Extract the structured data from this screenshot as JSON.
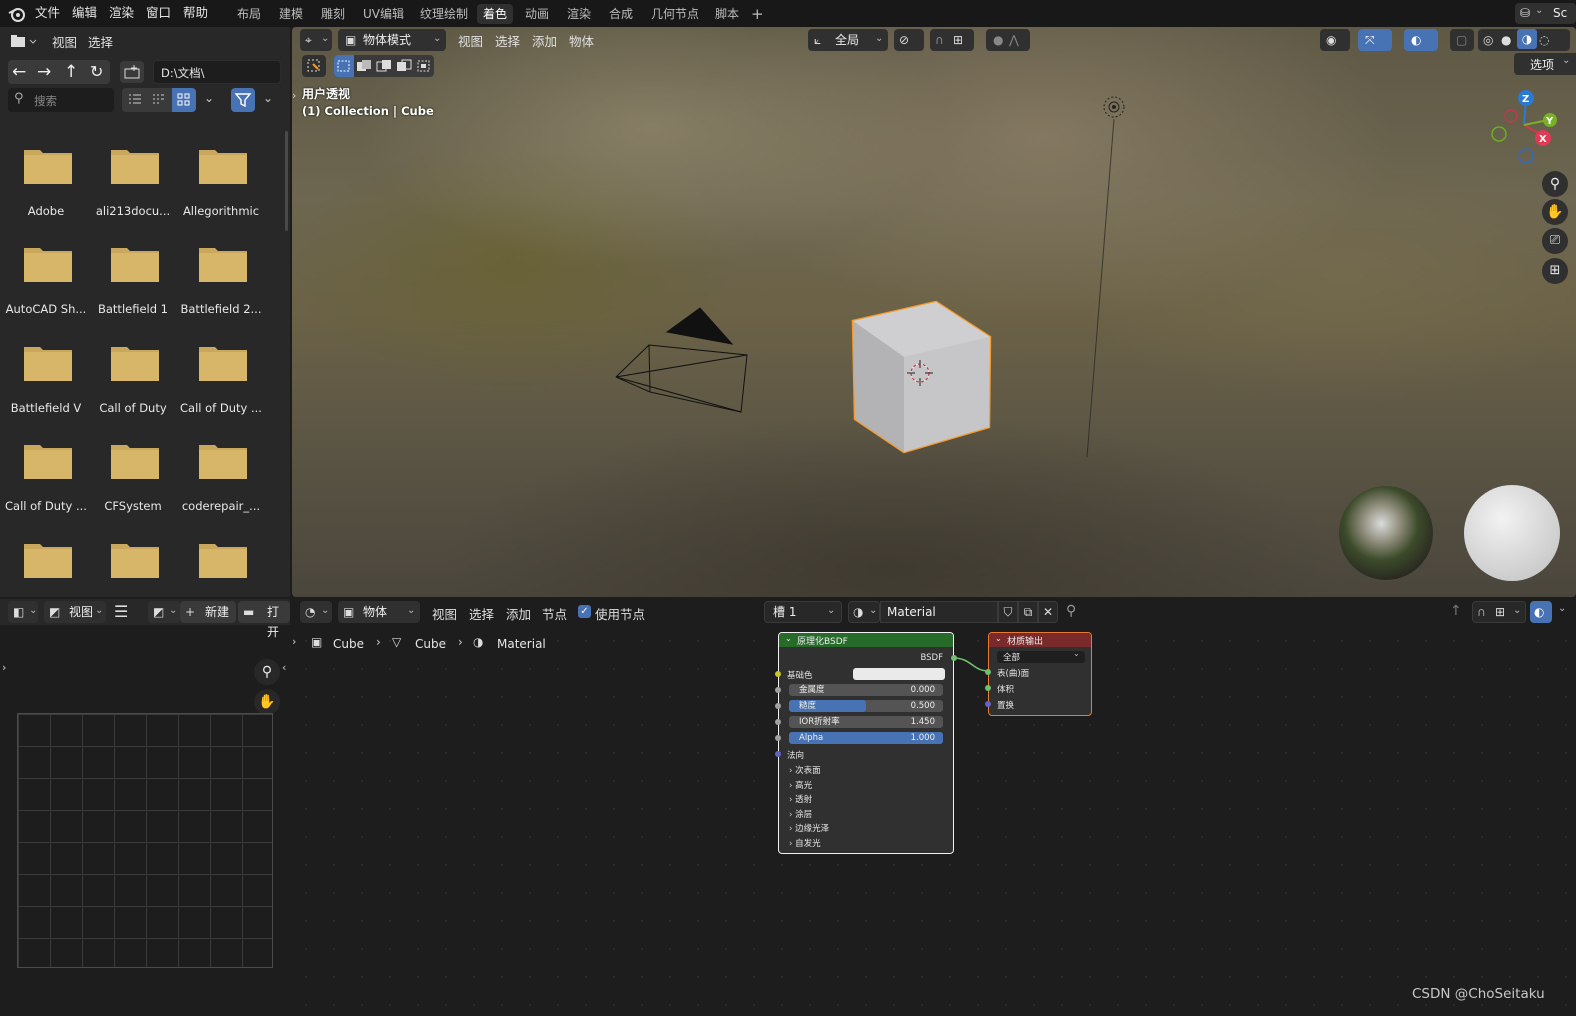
{
  "menubar": {
    "items": [
      "文件",
      "编辑",
      "渲染",
      "窗口",
      "帮助"
    ],
    "workspace_tabs": [
      "布局",
      "建模",
      "雕刻",
      "UV编辑",
      "纹理绘制",
      "着色",
      "动画",
      "渲染",
      "合成",
      "几何节点",
      "脚本"
    ],
    "active_tab": "着色",
    "add_tab": "+",
    "scene_label": "Sc"
  },
  "file_browser": {
    "header": {
      "view": "视图",
      "select": "选择"
    },
    "path": "D:\\文档\\",
    "search_placeholder": "搜索",
    "folders": [
      "Adobe",
      "ali213docu...",
      "Allegorithmic",
      "AutoCAD Sh...",
      "Battlefield 1",
      "Battlefield 2...",
      "Battlefield V",
      "Call of Duty",
      "Call of Duty ...",
      "Call of Duty ...",
      "CFSystem",
      "coderepair_...",
      "",
      "",
      ""
    ]
  },
  "viewport": {
    "header": {
      "mode": "物体模式",
      "view": "视图",
      "select": "选择",
      "add": "添加",
      "object": "物体",
      "transform": "全局",
      "options": "选项"
    },
    "overlay_title": "用户透视",
    "overlay_subtitle": "(1) Collection | Cube",
    "gizmo": {
      "z": "Z",
      "y": "Y",
      "x": "X"
    }
  },
  "image_editor": {
    "header": {
      "view": "视图",
      "new": "新建",
      "open": "打开"
    }
  },
  "node_editor": {
    "header": {
      "object": "物体",
      "view": "视图",
      "select": "选择",
      "add": "添加",
      "node": "节点",
      "use_nodes": "使用节点",
      "slot": "槽 1",
      "material": "Material"
    },
    "breadcrumb": [
      "Cube",
      "Cube",
      "Material"
    ],
    "bsdf_node": {
      "title": "原理化BSDF",
      "output": "BSDF",
      "base_color": "基础色",
      "fields": [
        {
          "label": "金属度",
          "value": "0.000",
          "fill": 0.0
        },
        {
          "label": "糙度",
          "value": "0.500",
          "fill": 0.5
        },
        {
          "label": "IOR折射率",
          "value": "1.450",
          "fill": 0.0
        },
        {
          "label": "Alpha",
          "value": "1.000",
          "fill": 1.0
        }
      ],
      "normal": "法向",
      "panels": [
        "次表面",
        "高光",
        "透射",
        "涂层",
        "边缘光泽",
        "自发光"
      ]
    },
    "output_node": {
      "title": "材质输出",
      "target": "全部",
      "inputs": [
        "表(曲)面",
        "体积",
        "置换"
      ]
    }
  },
  "watermark": "CSDN @ChoSeitaku",
  "colors": {
    "accent": "#4772b3",
    "selection": "#f59a2b",
    "bsdf_header": "#276b2b",
    "output_header": "#7a2a2a",
    "folder": "#d7b669"
  }
}
